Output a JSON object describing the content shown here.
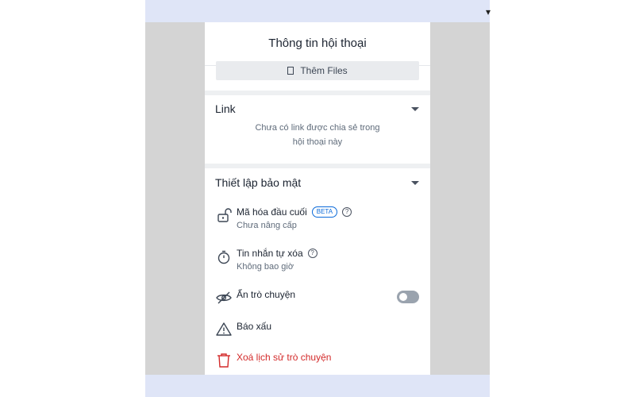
{
  "panel": {
    "title": "Thông tin hội thoại",
    "add_files_label": "Thêm Files"
  },
  "link_section": {
    "title": "Link",
    "empty_line1": "Chưa có link được chia sẻ trong",
    "empty_line2": "hội thoại này"
  },
  "security_section": {
    "title": "Thiết lập bảo mật",
    "items": [
      {
        "title": "Mã hóa đầu cuối",
        "badge": "BETA",
        "help": "?",
        "subtitle": "Chưa nâng cấp",
        "icon": "unlock-icon"
      },
      {
        "title": "Tin nhắn tự xóa",
        "help": "?",
        "subtitle": "Không bao giờ",
        "icon": "stopwatch-icon"
      },
      {
        "title": "Ẩn trò chuyện",
        "icon": "eye-off-icon",
        "toggle_on": false
      },
      {
        "title": "Báo xấu",
        "icon": "warning-icon"
      },
      {
        "title": "Xoá lịch sử trò chuyện",
        "icon": "trash-icon",
        "color": "#d32a2a"
      }
    ]
  },
  "colors": {
    "background_band": "#dfe5f7",
    "side_gray": "#d4d4d4",
    "danger": "#d32a2a",
    "beta_blue": "#0b6ad9"
  }
}
